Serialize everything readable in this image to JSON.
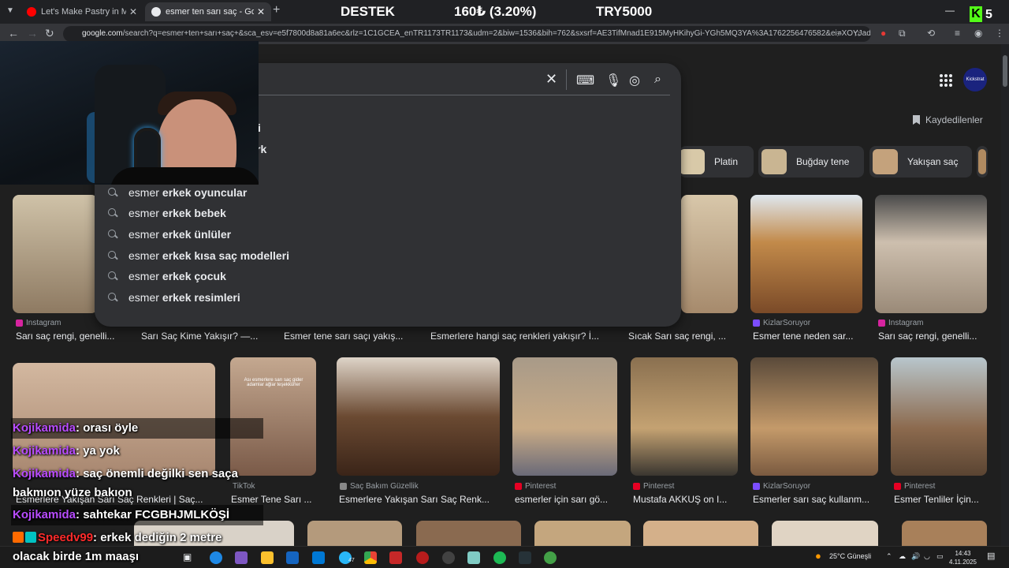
{
  "browser": {
    "tabs": [
      {
        "title": "Let's Make Pastry in My Germa",
        "active": false
      },
      {
        "title": "esmer ten sarı saç - Google'da A",
        "active": true
      }
    ],
    "new_tab": "+",
    "url_host": "google.com",
    "url_rest": "/search?q=esmer+ten+sarı+saç+&sca_esv=e5f7800d8a81a6ec&rlz=1C1GCEA_enTR1173TR1173&udm=2&biw=1536&bih=762&sxsrf=AE3TifMnad1E915MyHKihyGi-YGh5MQ3YA%3A1762256476582&ei=XOYJad-nl..."
  },
  "overlay": {
    "destek": "DESTEK",
    "amount": "160₺ (3.20%)",
    "goal": "TRY5000",
    "kick_logo": "K",
    "kick_count": "5"
  },
  "search": {
    "partial_suggestions": [
      "i",
      "rk"
    ],
    "suggestions": [
      {
        "prefix": "esmer",
        "bold": "erkek oyuncular"
      },
      {
        "prefix": "esmer",
        "bold": "erkek bebek"
      },
      {
        "prefix": "esmer",
        "bold": "erkek ünlüler"
      },
      {
        "prefix": "esmer",
        "bold": "erkek kısa saç modelleri"
      },
      {
        "prefix": "esmer",
        "bold": "erkek çocuk"
      },
      {
        "prefix": "esmer",
        "bold": "erkek resimleri"
      }
    ]
  },
  "header": {
    "saved_label": "Kaydedilenler",
    "account_label": "Kickstrat"
  },
  "chips": [
    {
      "label": "Platin",
      "color": "#d8c9a8"
    },
    {
      "label": "Buğday tene",
      "color": "#c9b592"
    },
    {
      "label": "Yakışan saç",
      "color": "#c4a27c"
    }
  ],
  "results_row1": [
    {
      "source": "Instagram",
      "caption": "Sarı saç rengi, genelli...",
      "color": "#b8a58a"
    },
    {
      "source": "",
      "caption": "Sarı Saç Kime Yakışır? —...",
      "color": ""
    },
    {
      "source": "",
      "caption": "Esmer tene sarı saçı yakış...",
      "color": ""
    },
    {
      "source": "",
      "caption": "Esmerlere hangi saç renkleri yakışır? İ...",
      "color": ""
    },
    {
      "source": "",
      "caption": "Sıcak Sarı saç rengi, ...",
      "color": "#bfa88a"
    },
    {
      "source": "KizlarSoruyor",
      "caption": "Esmer tene neden sar...",
      "color": "#b58a4e"
    },
    {
      "source": "Instagram",
      "caption": "Sarı saç rengi, genelli...",
      "color": "#a89c8c"
    }
  ],
  "results_row2": [
    {
      "source": "Saç Bakım Güzellik",
      "caption": "Esmerlere Yakışan Sarı Saç Renkleri | Saç...",
      "color": "#c9a48c"
    },
    {
      "source": "TikTok",
      "caption": "Esmer Tene Sarı ...",
      "color": "#b38f78"
    },
    {
      "source": "Saç Bakım Güzellik",
      "caption": "Esmerlere Yakışan Sarı Saç Renk...",
      "color": "#8c6a50"
    },
    {
      "source": "Pinterest",
      "caption": "esmerler için sarı gö...",
      "color": "#b69a7c"
    },
    {
      "source": "Pinterest",
      "caption": "Mustafa AKKUŞ on I...",
      "color": "#9e7c58"
    },
    {
      "source": "KizlarSoruyor",
      "caption": "Esmerler sarı saç kullanm...",
      "color": "#a88460"
    },
    {
      "source": "Pinterest",
      "caption": "Esmer Tenliler İçin...",
      "color": "#8e6a4e"
    }
  ],
  "tiktok_overlay_text": "Ası esmerlere sarı saç gider\nadamlar ağlar teşekkürler",
  "chat": [
    {
      "user": "Kojikamida",
      "message": ": orası öyle"
    },
    {
      "user": "Kojikamida",
      "message": ": ya yok"
    },
    {
      "user": "Kojikamida",
      "message": ": saç önemli değilki sen saça"
    },
    {
      "user": "",
      "message": "bakmıon yüze bakıon"
    },
    {
      "user": "Kojikamida",
      "message": ": sahtekar FCGBHJMLKÖŞİ"
    },
    {
      "user": "Speedv99",
      "message": ": erkek dediğin 2 metre"
    },
    {
      "user": "",
      "message": "olacak birde 1m maaşı"
    }
  ],
  "taskbar": {
    "weather": "25°C  Güneşli",
    "time": "14:43",
    "date": "4.11.2025",
    "badge": "47"
  }
}
